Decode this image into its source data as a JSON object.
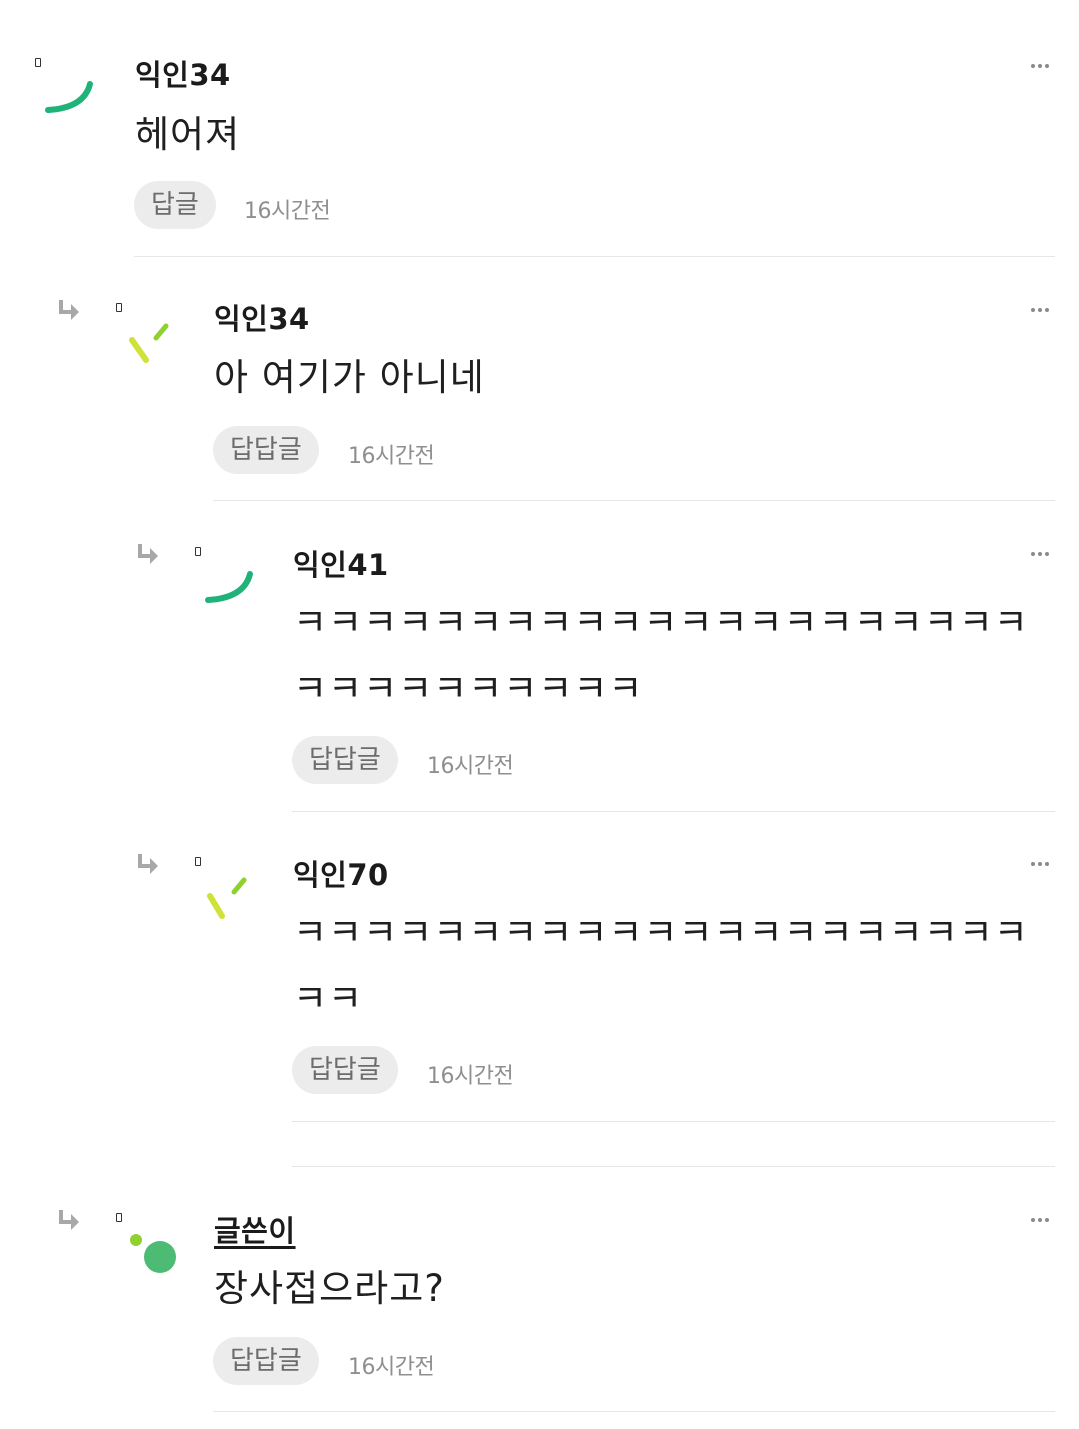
{
  "comments": [
    {
      "nickname": "익인34",
      "text": "헤어져",
      "reply_label": "답글",
      "time": "16시간전",
      "avatar": "green-arc-icon",
      "is_author": false
    },
    {
      "nickname": "익인34",
      "text": "아 여기가 아니네",
      "reply_label": "답답글",
      "time": "16시간전",
      "avatar": "lime-strokes-icon",
      "is_author": false
    },
    {
      "nickname": "익인41",
      "text": "ㅋㅋㅋㅋㅋㅋㅋㅋㅋㅋㅋㅋㅋㅋㅋㅋㅋㅋㅋㅋㅋㅋㅋㅋㅋㅋㅋㅋㅋㅋㅋ",
      "reply_label": "답답글",
      "time": "16시간전",
      "avatar": "green-arc-icon",
      "is_author": false
    },
    {
      "nickname": "익인70",
      "text": "ㅋㅋㅋㅋㅋㅋㅋㅋㅋㅋㅋㅋㅋㅋㅋㅋㅋㅋㅋㅋㅋㅋㅋ",
      "reply_label": "답답글",
      "time": "16시간전",
      "avatar": "lime-strokes-icon",
      "is_author": false
    },
    {
      "nickname": "글쓴이",
      "text": "장사접으라고?",
      "reply_label": "답답글",
      "time": "16시간전",
      "avatar": "green-dots-icon",
      "is_author": true
    }
  ],
  "colors": {
    "accent_green": "#1fb37a",
    "lime": "#8fd22f",
    "yellow_lime": "#cfe23a",
    "dot_green": "#4dbb74"
  }
}
